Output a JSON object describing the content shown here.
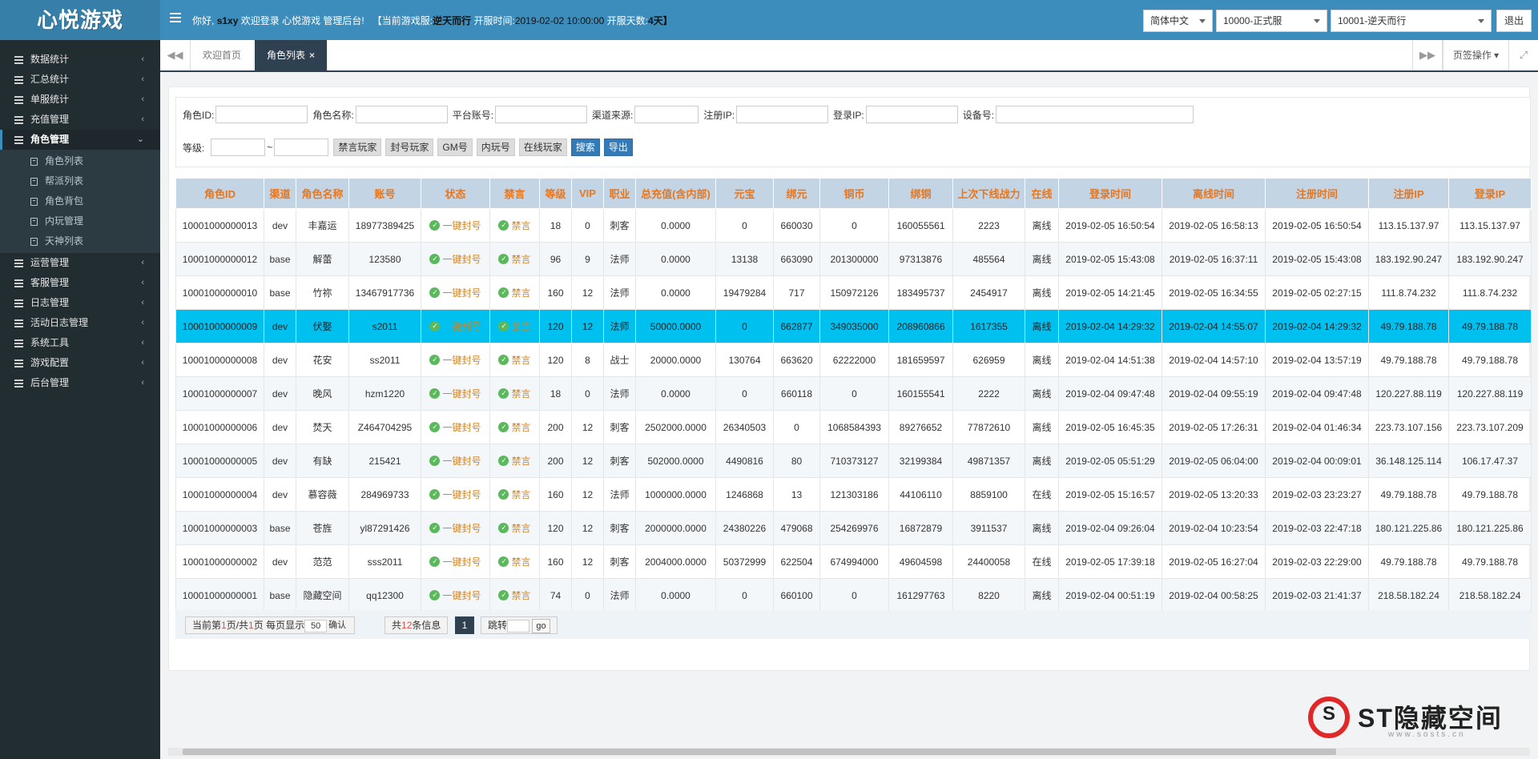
{
  "app": {
    "logo": "心悦游戏"
  },
  "header": {
    "greet_prefix": "你好,",
    "username": "s1xy",
    "greet_suffix": "欢迎登录 心悦游戏 管理后台!",
    "server_prefix": "【当前游戏服:",
    "server_name": "逆天而行",
    "open_time_label": "开服时间:",
    "open_time": "2019-02-02 10:00:00",
    "open_days_label": "开服天数:",
    "open_days": "4天】",
    "lang_select": "简体中文",
    "server_group_select": "10000-正式服",
    "server_select": "10001-逆天而行",
    "logout": "退出"
  },
  "sidebar": {
    "items_before": [
      "数据统计",
      "汇总统计",
      "单服统计",
      "充值管理"
    ],
    "active": "角色管理",
    "sub_items": [
      "角色列表",
      "帮派列表",
      "角色背包",
      "内玩管理",
      "天神列表"
    ],
    "items_after": [
      "运营管理",
      "客服管理",
      "日志管理",
      "活动日志管理",
      "系统工具",
      "游戏配置",
      "后台管理"
    ]
  },
  "tabs": {
    "home": "欢迎首页",
    "current": "角色列表",
    "close_mark": "×",
    "prev_icon": "◀◀",
    "next_icon": "▶▶",
    "ops": "页签操作 ▾",
    "fullscreen_icon": "⤢"
  },
  "filters": {
    "role_id": "角色ID:",
    "role_name": "角色名称:",
    "platform_account": "平台账号:",
    "channel": "渠道来源:",
    "reg_ip": "注册IP:",
    "login_ip": "登录IP:",
    "device": "设备号:",
    "level": "等级:",
    "range_sep": "~",
    "buttons": [
      "禁言玩家",
      "封号玩家",
      "GM号",
      "内玩号",
      "在线玩家"
    ],
    "search": "搜索",
    "export": "导出"
  },
  "table": {
    "headers": [
      "角色ID",
      "渠道",
      "角色名称",
      "账号",
      "状态",
      "禁言",
      "等级",
      "VIP",
      "职业",
      "总充值(含内部)",
      "元宝",
      "绑元",
      "铜币",
      "绑铜",
      "上次下线战力",
      "在线",
      "登录时间",
      "离线时间",
      "注册时间",
      "注册IP",
      "登录IP"
    ],
    "status_label": "一键封号",
    "mute_label": "禁言",
    "rows": [
      [
        "10001000000013",
        "dev",
        "丰嘉运",
        "18977389425",
        "18",
        "0",
        "刺客",
        "0.0000",
        "0",
        "660030",
        "0",
        "160055561",
        "2223",
        "离线",
        "2019-02-05 16:50:54",
        "2019-02-05 16:58:13",
        "2019-02-05 16:50:54",
        "113.15.137.97",
        "113.15.137.97"
      ],
      [
        "10001000000012",
        "base",
        "解蕾",
        "123580",
        "96",
        "9",
        "法师",
        "0.0000",
        "13138",
        "663090",
        "201300000",
        "97313876",
        "485564",
        "离线",
        "2019-02-05 15:43:08",
        "2019-02-05 16:37:11",
        "2019-02-05 15:43:08",
        "183.192.90.247",
        "183.192.90.247"
      ],
      [
        "10001000000010",
        "base",
        "竹祢",
        "13467917736",
        "160",
        "12",
        "法师",
        "0.0000",
        "19479284",
        "717",
        "150972126",
        "183495737",
        "2454917",
        "离线",
        "2019-02-05 14:21:45",
        "2019-02-05 16:34:55",
        "2019-02-05 02:27:15",
        "111.8.74.232",
        "111.8.74.232"
      ],
      [
        "10001000000009",
        "dev",
        "伏娶",
        "s2011",
        "120",
        "12",
        "法师",
        "50000.0000",
        "0",
        "662877",
        "349035000",
        "208960866",
        "1617355",
        "离线",
        "2019-02-04 14:29:32",
        "2019-02-04 14:55:07",
        "2019-02-04 14:29:32",
        "49.79.188.78",
        "49.79.188.78"
      ],
      [
        "10001000000008",
        "dev",
        "花安",
        "ss2011",
        "120",
        "8",
        "战士",
        "20000.0000",
        "130764",
        "663620",
        "62222000",
        "181659597",
        "626959",
        "离线",
        "2019-02-04 14:51:38",
        "2019-02-04 14:57:10",
        "2019-02-04 13:57:19",
        "49.79.188.78",
        "49.79.188.78"
      ],
      [
        "10001000000007",
        "dev",
        "晚风",
        "hzm1220",
        "18",
        "0",
        "法师",
        "0.0000",
        "0",
        "660118",
        "0",
        "160155541",
        "2222",
        "离线",
        "2019-02-04 09:47:48",
        "2019-02-04 09:55:19",
        "2019-02-04 09:47:48",
        "120.227.88.119",
        "120.227.88.119"
      ],
      [
        "10001000000006",
        "dev",
        "焚天",
        "Z464704295",
        "200",
        "12",
        "刺客",
        "2502000.0000",
        "26340503",
        "0",
        "1068584393",
        "89276652",
        "77872610",
        "离线",
        "2019-02-05 16:45:35",
        "2019-02-05 17:26:31",
        "2019-02-04 01:46:34",
        "223.73.107.156",
        "223.73.107.209"
      ],
      [
        "10001000000005",
        "dev",
        "有缺",
        "215421",
        "200",
        "12",
        "刺客",
        "502000.0000",
        "4490816",
        "80",
        "710373127",
        "32199384",
        "49871357",
        "离线",
        "2019-02-05 05:51:29",
        "2019-02-05 06:04:00",
        "2019-02-04 00:09:01",
        "36.148.125.114",
        "106.17.47.37"
      ],
      [
        "10001000000004",
        "dev",
        "慕容薇",
        "284969733",
        "160",
        "12",
        "法师",
        "1000000.0000",
        "1246868",
        "13",
        "121303186",
        "44106110",
        "8859100",
        "在线",
        "2019-02-05 15:16:57",
        "2019-02-05 13:20:33",
        "2019-02-03 23:23:27",
        "49.79.188.78",
        "49.79.188.78"
      ],
      [
        "10001000000003",
        "base",
        "苍旌",
        "yl87291426",
        "120",
        "12",
        "刺客",
        "2000000.0000",
        "24380226",
        "479068",
        "254269976",
        "16872879",
        "3911537",
        "离线",
        "2019-02-04 09:26:04",
        "2019-02-04 10:23:54",
        "2019-02-03 22:47:18",
        "180.121.225.86",
        "180.121.225.86"
      ],
      [
        "10001000000002",
        "dev",
        "范范",
        "sss2011",
        "160",
        "12",
        "刺客",
        "2004000.0000",
        "50372999",
        "622504",
        "674994000",
        "49604598",
        "24400058",
        "在线",
        "2019-02-05 17:39:18",
        "2019-02-05 16:27:04",
        "2019-02-03 22:29:00",
        "49.79.188.78",
        "49.79.188.78"
      ],
      [
        "10001000000001",
        "base",
        "隐藏空间",
        "qq12300",
        "74",
        "0",
        "法师",
        "0.0000",
        "0",
        "660100",
        "0",
        "161297763",
        "8220",
        "离线",
        "2019-02-04 00:51:19",
        "2019-02-04 00:58:25",
        "2019-02-03 21:41:37",
        "218.58.182.24",
        "218.58.182.24"
      ]
    ],
    "selected_row": 3
  },
  "pager": {
    "current_prefix": "当前第",
    "current_page": "1",
    "page_of": "页/共",
    "total_pages": "1",
    "page_size_label": "页 每页显示",
    "page_size": "50",
    "confirm": "确认",
    "total_prefix": "共",
    "total_count": "12",
    "total_suffix": "条信息",
    "page_button": "1",
    "jump_label": "跳转",
    "go": "go"
  },
  "watermark": {
    "text": "ST隐藏空间",
    "url": "www.sosts.cn",
    "brand_color": "#e02828"
  },
  "colors": {
    "header": "#3c8dbc",
    "sidebar": "#222d32",
    "selected_row": "#00c0ef",
    "header_text": "#e6771f"
  }
}
